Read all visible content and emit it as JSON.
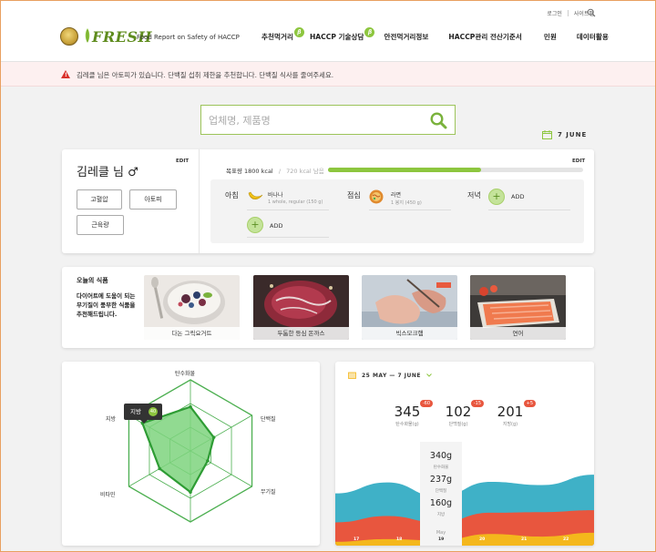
{
  "header": {
    "util": {
      "login": "로그인",
      "sitemap": "사이트맵"
    },
    "logo_text": "FRESH",
    "logo_sub": "Food Report on Safety of HACCP",
    "nav": [
      {
        "label": "추천먹거리",
        "badge": "β"
      },
      {
        "label": "HACCP 기술상담",
        "badge": "β"
      },
      {
        "label": "안전먹거리정보"
      },
      {
        "label": "HACCP관리 전산기준서"
      },
      {
        "label": "민원"
      },
      {
        "label": "데이터활용"
      }
    ]
  },
  "alert": {
    "icon": "warning-icon",
    "text": "김레클 님은 아토피가 있습니다. 단백질 섭취 제한을 추천합니다. 단백질 식사를 줄여주세요."
  },
  "search": {
    "placeholder": "업체명, 제품명",
    "icon": "search-icon"
  },
  "date": "7 JUNE",
  "profile": {
    "name": "김레클 님 ♂",
    "edit": "EDIT",
    "tags": [
      "고혈압",
      "아토피",
      "근육량"
    ],
    "goal_label": "목표량 1800 kcal",
    "goal_sep": "/",
    "remaining": "720 kcal 남음",
    "progress": 0.6,
    "edit2": "EDIT",
    "meals": {
      "breakfast": {
        "label": "아침",
        "food": "바나나",
        "detail": "1 whole, regular (150 g)"
      },
      "lunch": {
        "label": "점심",
        "food": "라면",
        "detail": "1 봉지 (450 g)"
      },
      "dinner": {
        "label": "저녁",
        "add": "ADD"
      },
      "extra_add": "ADD"
    }
  },
  "recommend": {
    "title": "오늘의 식품",
    "desc": "다이어트에 도움이 되는 무기질이 풍부한 식품을 추천해드립니다.",
    "items": [
      "다논 그릭요거트",
      "두툼한 등심 돈까스",
      "빅스모크햄",
      "연어"
    ]
  },
  "radar": {
    "axes": [
      "탄수화물",
      "단백질",
      "무기질",
      "",
      "비타민",
      "지방"
    ],
    "values": [
      0.62,
      0.38,
      0.28,
      0.58,
      0.5,
      0.78
    ],
    "tooltip": {
      "label": "지방",
      "value": "40"
    },
    "colors": {
      "fill": "#7ed37e",
      "stroke": "#2e9c34",
      "grid": "#4caf50"
    }
  },
  "weekly": {
    "range": "25 MAY — 7 JUNE",
    "stats": [
      {
        "value": "345",
        "label": "탄수화물(g)",
        "delta": "-60"
      },
      {
        "value": "102",
        "label": "단백질(g)",
        "delta": "-15"
      },
      {
        "value": "201",
        "label": "지방(g)",
        "delta": "+5"
      }
    ],
    "day": {
      "carb": "340g",
      "carb_l": "탄수화물",
      "prot": "237g",
      "prot_l": "단백질",
      "fat": "160g",
      "fat_l": "지방",
      "month": "May",
      "num": "19"
    },
    "x_labels": [
      "17",
      "18",
      "19",
      "20",
      "21",
      "22",
      "23"
    ],
    "chart_data": {
      "type": "area",
      "x": [
        "17",
        "18",
        "19",
        "20",
        "21",
        "22",
        "23"
      ],
      "series": [
        {
          "name": "탄수화물",
          "values": [
            45,
            52,
            40,
            48,
            42,
            55,
            50
          ],
          "color": "#3fb1c7"
        },
        {
          "name": "단백질",
          "values": [
            30,
            36,
            28,
            33,
            38,
            35,
            40
          ],
          "color": "#e8563e"
        },
        {
          "name": "지방",
          "values": [
            6,
            10,
            8,
            18,
            14,
            20,
            38
          ],
          "color": "#f4b71c"
        }
      ]
    }
  }
}
